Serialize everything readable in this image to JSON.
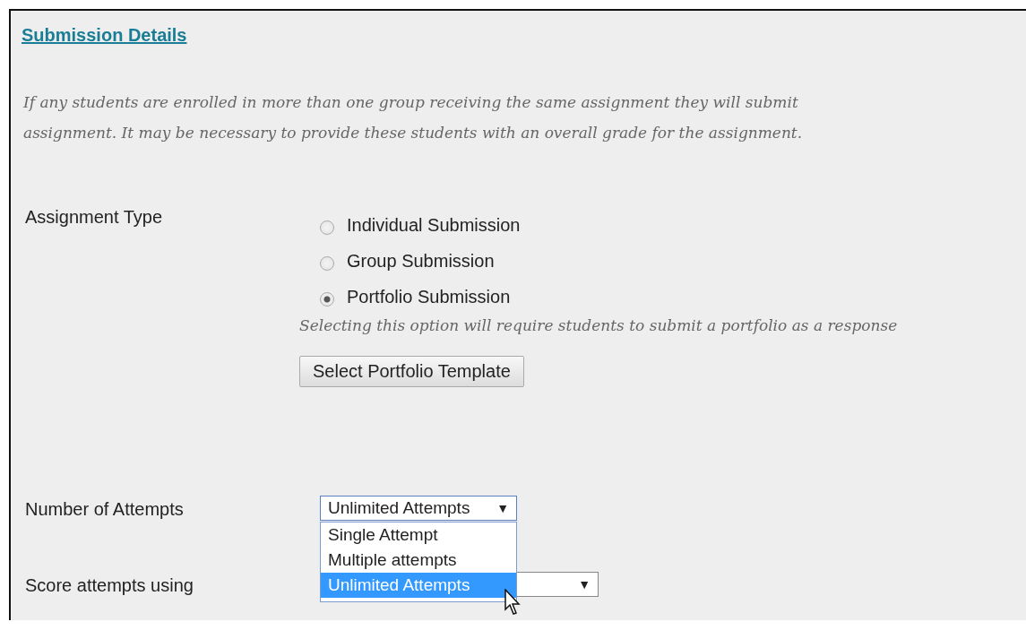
{
  "section": {
    "title": "Submission Details",
    "note_lines": [
      "If any students are enrolled in more than one group receiving the same assignment they will submit",
      "assignment. It may be necessary to provide these students with an overall grade for the assignment."
    ]
  },
  "assignment_type": {
    "label": "Assignment Type",
    "options": [
      {
        "label": "Individual Submission",
        "selected": false
      },
      {
        "label": "Group Submission",
        "selected": false
      },
      {
        "label": "Portfolio Submission",
        "selected": true
      }
    ],
    "help": "Selecting this option will require students to submit a portfolio as a response",
    "button": "Select Portfolio Template"
  },
  "attempts": {
    "label": "Number of Attempts",
    "value": "Unlimited Attempts",
    "caret": "▼",
    "expanded": true,
    "options": [
      {
        "label": "Single Attempt",
        "selected": false
      },
      {
        "label": "Multiple attempts",
        "selected": false
      },
      {
        "label": "Unlimited Attempts",
        "selected": true
      }
    ]
  },
  "score": {
    "label": "Score attempts using",
    "caret": "▼"
  }
}
